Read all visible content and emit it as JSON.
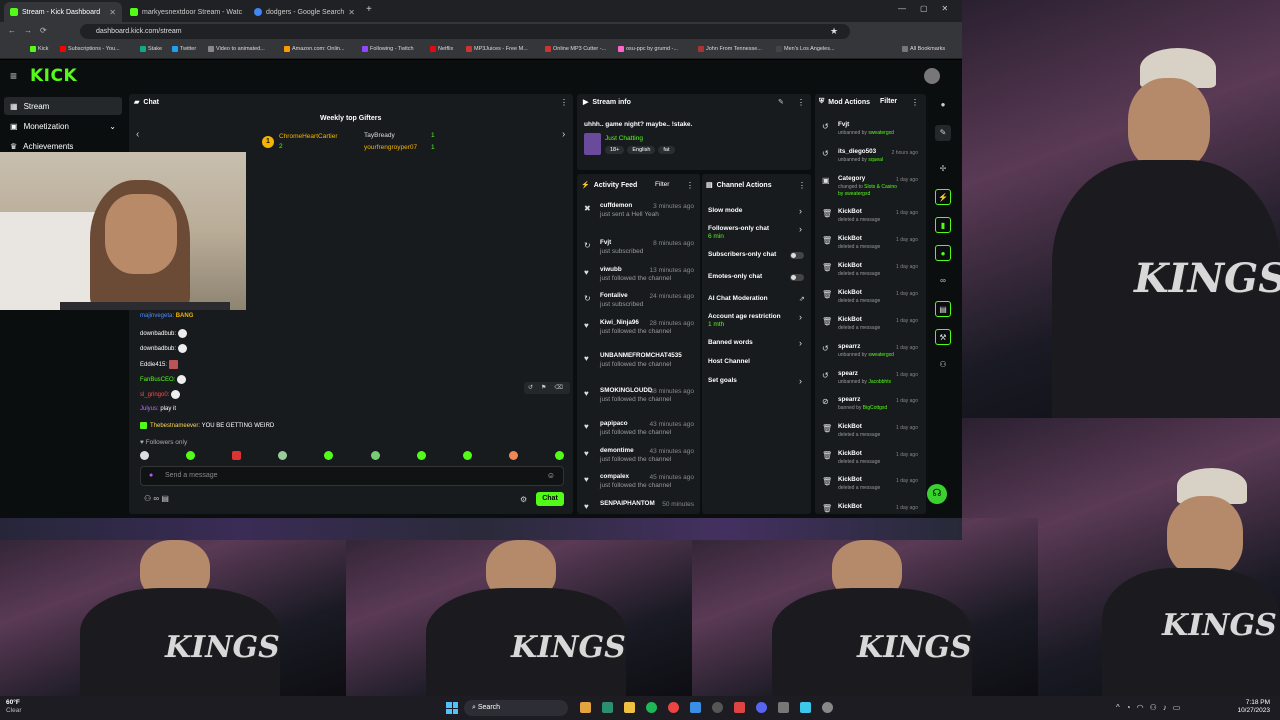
{
  "tabs": [
    {
      "label": "Stream - Kick Dashboard",
      "color": "#53fc18"
    },
    {
      "label": "markyesnextdoor Stream - Watc",
      "color": "#53fc18"
    },
    {
      "label": "dodgers - Google Search",
      "color": "#4285f4"
    }
  ],
  "url": "dashboard.kick.com/stream",
  "bookmarks": [
    "Kick",
    "Subscriptions - You...",
    "Stake",
    "Twitter",
    "Video to animated...",
    "Amazon.com: Onlin...",
    "Following - Twitch",
    "Netflix",
    "MP3Juices - Free M...",
    "Online MP3 Cutter -...",
    "osu-ppc by grumd -...",
    "John From Tennesse...",
    "Men's Los Angeles...",
    "All Bookmarks"
  ],
  "brand": {
    "logo": "KICK",
    "accent": "#53fc18"
  },
  "sidebar": [
    {
      "label": "Stream",
      "icon": "grid-icon"
    },
    {
      "label": "Monetization",
      "icon": "dollar-icon"
    },
    {
      "label": "Achievements",
      "icon": "trophy-icon"
    }
  ],
  "chat": {
    "title": "Chat",
    "gifters_title": "Weekly top Gifters",
    "gifters": [
      {
        "name": "ChromeHeartCartier",
        "count": "2"
      },
      {
        "name": "TayBready",
        "count": "1"
      },
      {
        "name": "yourfrengroyper07",
        "count": "1"
      }
    ],
    "messages": [
      {
        "user": "majinvegeta:",
        "text": "BANG",
        "color": "#4a8cff"
      },
      {
        "user": "downbadbub:",
        "text": "",
        "color": "#e0e0e0"
      },
      {
        "user": "downbadbub:",
        "text": "",
        "color": "#e0e0e0"
      },
      {
        "user": "Eddie415:",
        "text": "",
        "color": "#e0e0e0"
      },
      {
        "user": "FanBusCEO:",
        "text": "",
        "color": "#e0e0e0"
      },
      {
        "user": "sl_gringo0:",
        "text": "",
        "color": "#ff4a4a"
      },
      {
        "user": "Julyus:",
        "text": "play it",
        "color": "#c36bff"
      },
      {
        "user": "Thebestnameever:",
        "text": "YOU BE GETTING WEIRD",
        "color": "#ffd84a"
      }
    ],
    "followers_only": "Followers only",
    "placeholder": "Send a message",
    "send": "Chat"
  },
  "stream_info": {
    "title": "Stream info",
    "stream_title": "uhhh.. game night? maybe.. !stake.",
    "category": "Just Chatting",
    "tags": [
      "18+",
      "English",
      "fat"
    ]
  },
  "activity": {
    "title": "Activity Feed",
    "filter": "Filter",
    "items": [
      {
        "user": "cuffdemon",
        "desc": "just sent a Hell Yeah",
        "time": "3 minutes ago",
        "icon": "gift-icon"
      },
      {
        "user": "Fvjt",
        "desc": "just subscribed",
        "time": "8 minutes ago",
        "icon": "star-icon"
      },
      {
        "user": "viwubb",
        "desc": "just followed the channel",
        "time": "13 minutes ago",
        "icon": "heart-icon"
      },
      {
        "user": "Fontalive",
        "desc": "just subscribed",
        "time": "24 minutes ago",
        "icon": "star-icon"
      },
      {
        "user": "Kiwi_Ninja96",
        "desc": "just followed the channel",
        "time": "28 minutes ago",
        "icon": "heart-icon"
      },
      {
        "user": "UNBANMEFROMCHAT4535",
        "desc": "just followed the channel",
        "time": "",
        "icon": "heart-icon"
      },
      {
        "user": "SMOKINGLOUDD",
        "desc": "just followed the channel",
        "time": "38 minutes ago",
        "icon": "heart-icon"
      },
      {
        "user": "papipaco",
        "desc": "just followed the channel",
        "time": "43 minutes ago",
        "icon": "heart-icon"
      },
      {
        "user": "demontime",
        "desc": "just followed the channel",
        "time": "43 minutes ago",
        "icon": "heart-icon"
      },
      {
        "user": "compalex",
        "desc": "just followed the channel",
        "time": "45 minutes ago",
        "icon": "heart-icon"
      },
      {
        "user": "SENPAIPHANTOM",
        "desc": "",
        "time": "50 minutes",
        "icon": "heart-icon"
      }
    ]
  },
  "channel_actions": {
    "title": "Channel Actions",
    "items": [
      {
        "label": "Slow mode",
        "sub": "",
        "ctrl": "arrow"
      },
      {
        "label": "Followers-only chat",
        "sub": "6 min",
        "ctrl": "arrow"
      },
      {
        "label": "Subscribers-only chat",
        "sub": "",
        "ctrl": "toggle"
      },
      {
        "label": "Emotes-only chat",
        "sub": "",
        "ctrl": "toggle"
      },
      {
        "label": "AI Chat Moderation",
        "sub": "",
        "ctrl": "link"
      },
      {
        "label": "Account age restriction",
        "sub": "1 mth",
        "ctrl": "arrow"
      },
      {
        "label": "Banned words",
        "sub": "",
        "ctrl": "arrow"
      },
      {
        "label": "Host Channel",
        "sub": "",
        "ctrl": "none"
      },
      {
        "label": "Set goals",
        "sub": "",
        "ctrl": "arrow"
      }
    ]
  },
  "mod_actions": {
    "title": "Mod Actions",
    "filter": "Filter",
    "items": [
      {
        "user": "Fvjt",
        "desc": "unbanned by",
        "by": "sweatergxd",
        "time": ""
      },
      {
        "user": "its_diego503",
        "desc": "unbanned by",
        "by": "squeal",
        "time": "2 hours ago"
      },
      {
        "user": "Category",
        "desc": "changed to",
        "by": "Slots & Casino",
        "extra": "by sweatergxd",
        "time": "1 day ago"
      },
      {
        "user": "KickBot",
        "desc": "deleted a message",
        "by": "",
        "time": "1 day ago"
      },
      {
        "user": "KickBot",
        "desc": "deleted a message",
        "by": "",
        "time": "1 day ago"
      },
      {
        "user": "KickBot",
        "desc": "deleted a message",
        "by": "",
        "time": "1 day ago"
      },
      {
        "user": "KickBot",
        "desc": "deleted a message",
        "by": "",
        "time": "1 day ago"
      },
      {
        "user": "KickBot",
        "desc": "deleted a message",
        "by": "",
        "time": "1 day ago"
      },
      {
        "user": "spearrz",
        "desc": "unbanned by",
        "by": "sweatergxd",
        "time": "1 day ago"
      },
      {
        "user": "spearz",
        "desc": "unbanned by",
        "by": "Jacobbhtx",
        "time": "1 day ago"
      },
      {
        "user": "spearrz",
        "desc": "banned by",
        "by": "BigCottgxd",
        "time": "1 day ago"
      },
      {
        "user": "KickBot",
        "desc": "deleted a message",
        "by": "",
        "time": "1 day ago"
      },
      {
        "user": "KickBot",
        "desc": "deleted a message",
        "by": "",
        "time": "1 day ago"
      },
      {
        "user": "KickBot",
        "desc": "deleted a message",
        "by": "",
        "time": "1 day ago"
      },
      {
        "user": "KickBot",
        "desc": "",
        "by": "",
        "time": "1 day ago"
      }
    ]
  },
  "video": {
    "jersey_text": "KINGS"
  },
  "taskbar": {
    "weather_temp": "60°F",
    "weather_desc": "Clear",
    "search": "Search",
    "time": "7:18 PM",
    "date": "10/27/2023"
  }
}
